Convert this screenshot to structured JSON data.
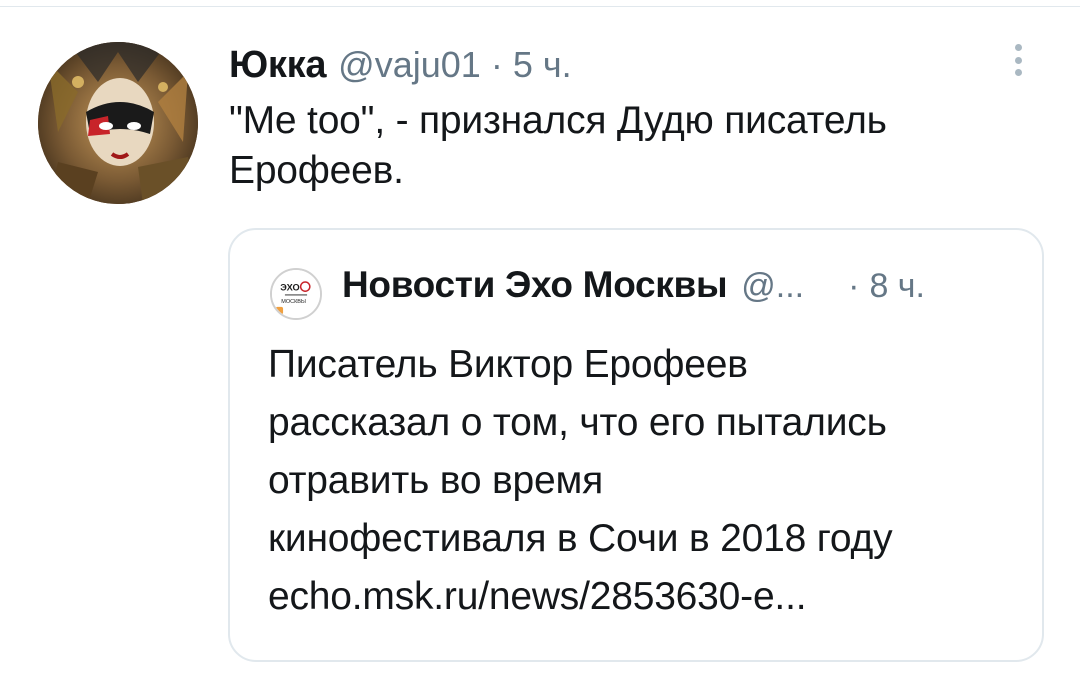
{
  "tweet": {
    "author": {
      "display_name": "Юкка",
      "handle": "@vaju01",
      "avatar_icon": "venetian-mask-avatar"
    },
    "separator": "·",
    "time": "5 ч.",
    "text": "\"Me too\", - признался Дудю писатель Ерофеев.",
    "more_icon": "vertical-ellipsis-icon"
  },
  "quoted_tweet": {
    "author": {
      "display_name": "Новости Эхо Москвы",
      "handle": "@...",
      "avatar_icon": "echo-moscow-logo"
    },
    "separator": "·",
    "time": "8 ч.",
    "text_lines": [
      "Писатель Виктор Ерофеев",
      "рассказал о том, что его пытались",
      "отравить во время",
      "кинофестиваля в Сочи в 2018 году",
      "echo.msk.ru/news/2853630-e..."
    ]
  },
  "colors": {
    "text_primary": "#14171a",
    "text_secondary": "#657786",
    "border": "#e1e8ed",
    "background": "#ffffff"
  }
}
